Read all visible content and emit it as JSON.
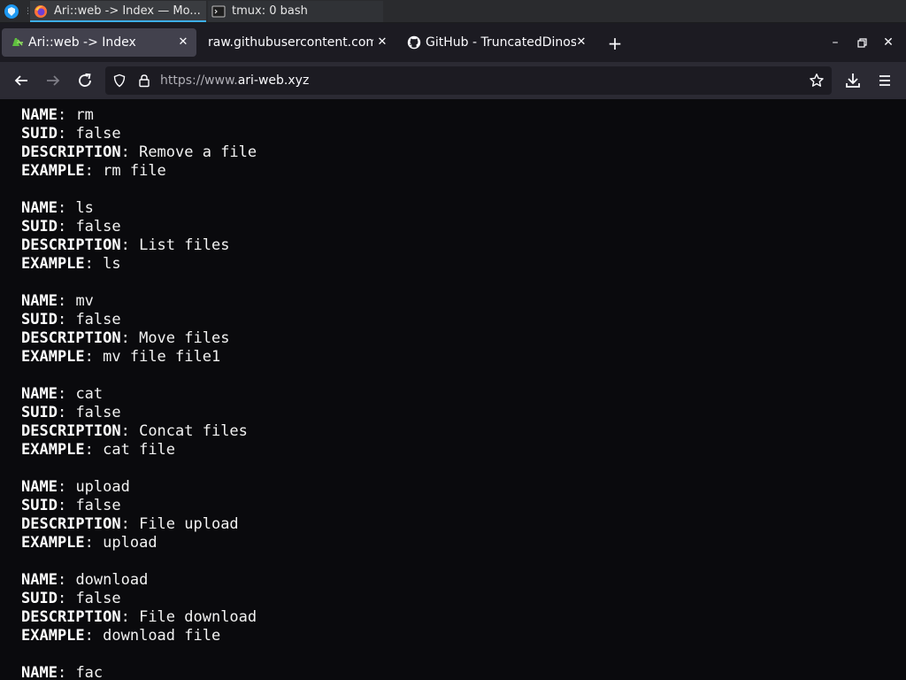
{
  "taskbar": {
    "tasks": [
      {
        "label": "Ari::web -> Index — Mo..."
      },
      {
        "label": "tmux: 0 bash"
      }
    ]
  },
  "tabs": [
    {
      "label": "Ari::web -> Index"
    },
    {
      "label": "raw.githubusercontent.com/"
    },
    {
      "label": "GitHub - TruncatedDinosour"
    }
  ],
  "urlbar": {
    "prefix": "https://www.",
    "host": "ari-web.xyz"
  },
  "field_labels": {
    "name": "NAME",
    "suid": "SUID",
    "description": "DESCRIPTION",
    "example": "EXAMPLE"
  },
  "entries": [
    {
      "name": "rm",
      "suid": "false",
      "description": "Remove a file",
      "example": "rm file"
    },
    {
      "name": "ls",
      "suid": "false",
      "description": "List files",
      "example": "ls"
    },
    {
      "name": "mv",
      "suid": "false",
      "description": "Move files",
      "example": "mv file file1"
    },
    {
      "name": "cat",
      "suid": "false",
      "description": "Concat files",
      "example": "cat file"
    },
    {
      "name": "upload",
      "suid": "false",
      "description": "File upload",
      "example": "upload"
    },
    {
      "name": "download",
      "suid": "false",
      "description": "File download",
      "example": "download file"
    },
    {
      "name": "fac",
      "suid": "",
      "description": "",
      "example": ""
    }
  ],
  "colors": {
    "page_background": "#0a0a0d",
    "toolbar": "#2b2a33",
    "tabstrip": "#1c1b22",
    "accent": "#3daee9"
  }
}
